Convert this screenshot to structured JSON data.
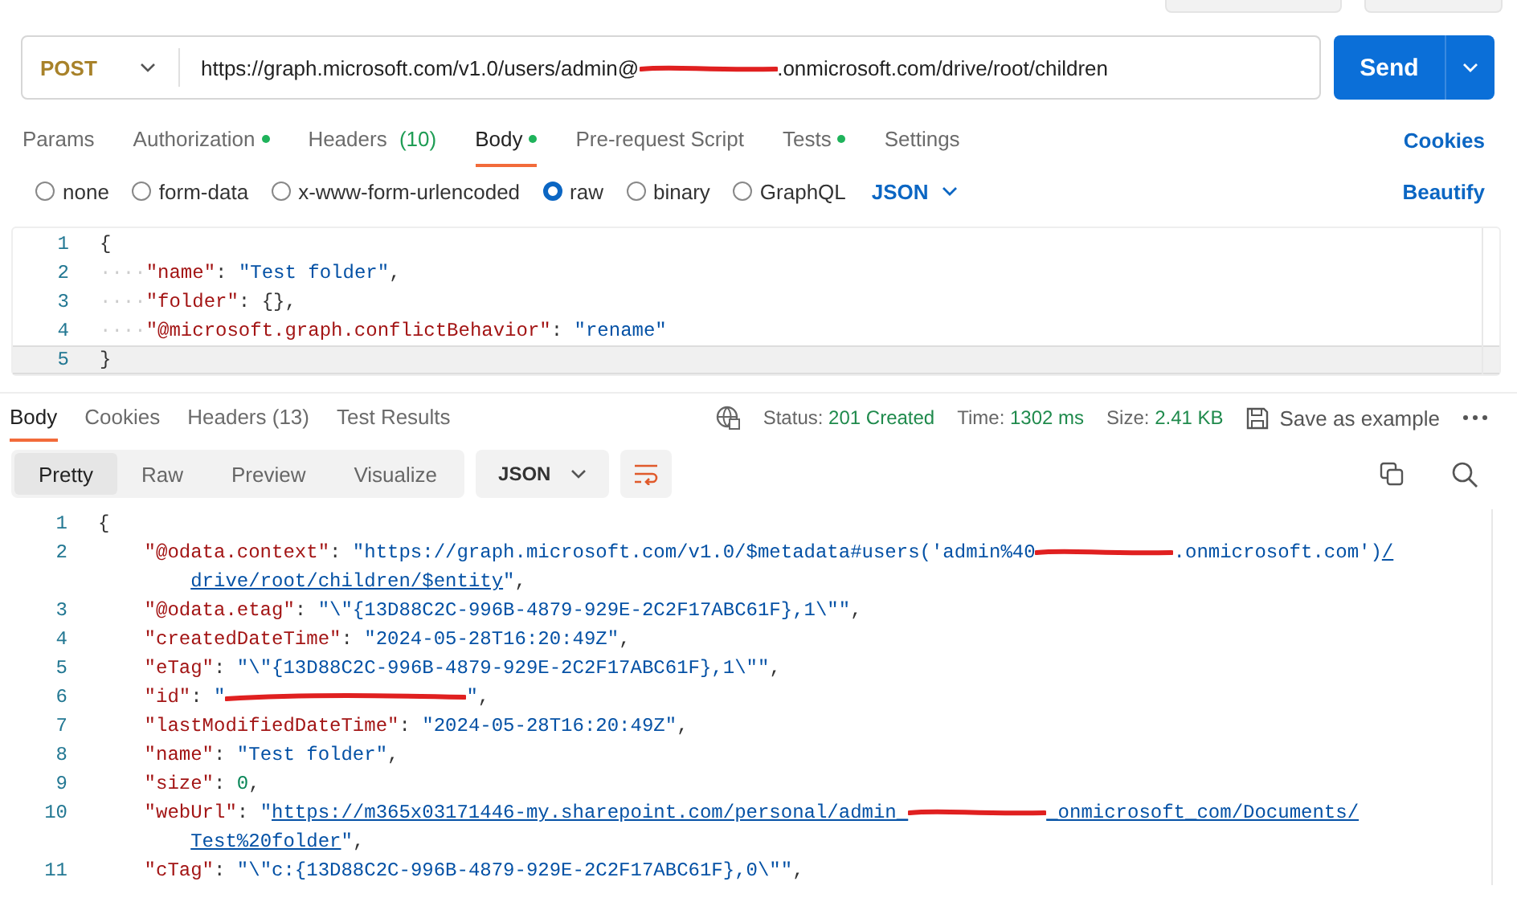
{
  "request": {
    "method": "POST",
    "url_parts": [
      {
        "kind": "text",
        "text": "https://graph.microsoft.com/v1.0/users/admin@"
      },
      {
        "kind": "redaction"
      },
      {
        "kind": "text",
        "text": ".onmicrosoft.com/drive/root/children"
      }
    ],
    "send": "Send"
  },
  "request_tabs": [
    {
      "label": "Params",
      "dot": false,
      "selected": false
    },
    {
      "label": "Authorization",
      "dot": true,
      "selected": false
    },
    {
      "label": "Headers",
      "count": "(10)",
      "dot": false,
      "selected": false
    },
    {
      "label": "Body",
      "dot": true,
      "selected": true
    },
    {
      "label": "Pre-request Script",
      "dot": false,
      "selected": false
    },
    {
      "label": "Tests",
      "dot": true,
      "selected": false
    },
    {
      "label": "Settings",
      "dot": false,
      "selected": false
    }
  ],
  "cookies_link": "Cookies",
  "body_types": [
    {
      "label": "none",
      "selected": false
    },
    {
      "label": "form-data",
      "selected": false
    },
    {
      "label": "x-www-form-urlencoded",
      "selected": false
    },
    {
      "label": "raw",
      "selected": true
    },
    {
      "label": "binary",
      "selected": false
    },
    {
      "label": "GraphQL",
      "selected": false
    }
  ],
  "raw_format": "JSON",
  "beautify": "Beautify",
  "request_body": [
    {
      "number": "1",
      "active": false,
      "parts": [
        {
          "kind": "punct",
          "text": "{"
        }
      ]
    },
    {
      "number": "2",
      "active": false,
      "parts": [
        {
          "kind": "ws",
          "text": "····"
        },
        {
          "kind": "key",
          "text": "\"name\""
        },
        {
          "kind": "punct",
          "text": ": "
        },
        {
          "kind": "string",
          "text": "\"Test folder\""
        },
        {
          "kind": "punct",
          "text": ","
        }
      ]
    },
    {
      "number": "3",
      "active": false,
      "parts": [
        {
          "kind": "ws",
          "text": "····"
        },
        {
          "kind": "key",
          "text": "\"folder\""
        },
        {
          "kind": "punct",
          "text": ": {},"
        }
      ]
    },
    {
      "number": "4",
      "active": false,
      "parts": [
        {
          "kind": "ws",
          "text": "····"
        },
        {
          "kind": "key",
          "text": "\"@microsoft.graph.conflictBehavior\""
        },
        {
          "kind": "punct",
          "text": ": "
        },
        {
          "kind": "string",
          "text": "\"rename\""
        }
      ]
    },
    {
      "number": "5",
      "active": true,
      "parts": [
        {
          "kind": "punct",
          "text": "}"
        }
      ]
    }
  ],
  "response_tabs": [
    {
      "label": "Body",
      "selected": true
    },
    {
      "label": "Cookies",
      "selected": false
    },
    {
      "label": "Headers (13)",
      "selected": false
    },
    {
      "label": "Test Results",
      "selected": false
    }
  ],
  "status": {
    "status_label": "Status:",
    "status_value": "201 Created",
    "time_label": "Time:",
    "time_value": "1302 ms",
    "size_label": "Size:",
    "size_value": "2.41 KB",
    "save": "Save as example"
  },
  "view_modes": [
    {
      "label": "Pretty",
      "selected": true
    },
    {
      "label": "Raw",
      "selected": false
    },
    {
      "label": "Preview",
      "selected": false
    },
    {
      "label": "Visualize",
      "selected": false
    }
  ],
  "response_format": "JSON",
  "response_body": [
    {
      "kind": "top",
      "number": "1",
      "parts": [
        {
          "kind": "punct",
          "text": "{"
        }
      ]
    },
    {
      "kind": "member",
      "number": "2",
      "parts": [
        {
          "kind": "key",
          "text": "\"@odata.context\""
        },
        {
          "kind": "punct",
          "text": ": "
        },
        {
          "kind": "string",
          "text": "\"https://graph.microsoft.com/v1.0/$metadata#users('admin%40"
        },
        {
          "kind": "redaction"
        },
        {
          "kind": "string",
          "text": ".onmicrosoft.com')"
        },
        {
          "kind": "link",
          "text": "/"
        }
      ]
    },
    {
      "kind": "wrap",
      "parts": [
        {
          "kind": "link",
          "text": "drive/root/children/$entity"
        },
        {
          "kind": "string",
          "text": "\""
        },
        {
          "kind": "punct",
          "text": ","
        }
      ]
    },
    {
      "kind": "member",
      "number": "3",
      "parts": [
        {
          "kind": "key",
          "text": "\"@odata.etag\""
        },
        {
          "kind": "punct",
          "text": ": "
        },
        {
          "kind": "string",
          "text": "\"\\\"{13D88C2C-996B-4879-929E-2C2F17ABC61F},1\\\"\""
        },
        {
          "kind": "punct",
          "text": ","
        }
      ]
    },
    {
      "kind": "member",
      "number": "4",
      "parts": [
        {
          "kind": "key",
          "text": "\"createdDateTime\""
        },
        {
          "kind": "punct",
          "text": ": "
        },
        {
          "kind": "string",
          "text": "\"2024-05-28T16:20:49Z\""
        },
        {
          "kind": "punct",
          "text": ","
        }
      ]
    },
    {
      "kind": "member",
      "number": "5",
      "parts": [
        {
          "kind": "key",
          "text": "\"eTag\""
        },
        {
          "kind": "punct",
          "text": ": "
        },
        {
          "kind": "string",
          "text": "\"\\\"{13D88C2C-996B-4879-929E-2C2F17ABC61F},1\\\"\""
        },
        {
          "kind": "punct",
          "text": ","
        }
      ]
    },
    {
      "kind": "member",
      "number": "6",
      "parts": [
        {
          "kind": "key",
          "text": "\"id\""
        },
        {
          "kind": "punct",
          "text": ": "
        },
        {
          "kind": "string",
          "text": "\""
        },
        {
          "kind": "redaction",
          "long": true
        },
        {
          "kind": "string",
          "text": "\""
        },
        {
          "kind": "punct",
          "text": ","
        }
      ]
    },
    {
      "kind": "member",
      "number": "7",
      "parts": [
        {
          "kind": "key",
          "text": "\"lastModifiedDateTime\""
        },
        {
          "kind": "punct",
          "text": ": "
        },
        {
          "kind": "string",
          "text": "\"2024-05-28T16:20:49Z\""
        },
        {
          "kind": "punct",
          "text": ","
        }
      ]
    },
    {
      "kind": "member",
      "number": "8",
      "parts": [
        {
          "kind": "key",
          "text": "\"name\""
        },
        {
          "kind": "punct",
          "text": ": "
        },
        {
          "kind": "string",
          "text": "\"Test folder\""
        },
        {
          "kind": "punct",
          "text": ","
        }
      ]
    },
    {
      "kind": "member",
      "number": "9",
      "parts": [
        {
          "kind": "key",
          "text": "\"size\""
        },
        {
          "kind": "punct",
          "text": ": "
        },
        {
          "kind": "number",
          "text": "0"
        },
        {
          "kind": "punct",
          "text": ","
        }
      ]
    },
    {
      "kind": "member",
      "number": "10",
      "parts": [
        {
          "kind": "key",
          "text": "\"webUrl\""
        },
        {
          "kind": "punct",
          "text": ": "
        },
        {
          "kind": "string",
          "text": "\""
        },
        {
          "kind": "link",
          "text": "https://m365x03171446-my.sharepoint.com/personal/admin_"
        },
        {
          "kind": "redaction"
        },
        {
          "kind": "link",
          "text": "_onmicrosoft_com/Documents/"
        }
      ]
    },
    {
      "kind": "wrap",
      "parts": [
        {
          "kind": "link",
          "text": "Test%20folder"
        },
        {
          "kind": "string",
          "text": "\""
        },
        {
          "kind": "punct",
          "text": ","
        }
      ]
    },
    {
      "kind": "member",
      "number": "11",
      "parts": [
        {
          "kind": "key",
          "text": "\"cTag\""
        },
        {
          "kind": "punct",
          "text": ": "
        },
        {
          "kind": "string",
          "text": "\"\\\"c:{13D88C2C-996B-4879-929E-2C2F17ABC61F},0\\\"\""
        },
        {
          "kind": "punct",
          "text": ","
        }
      ]
    }
  ]
}
